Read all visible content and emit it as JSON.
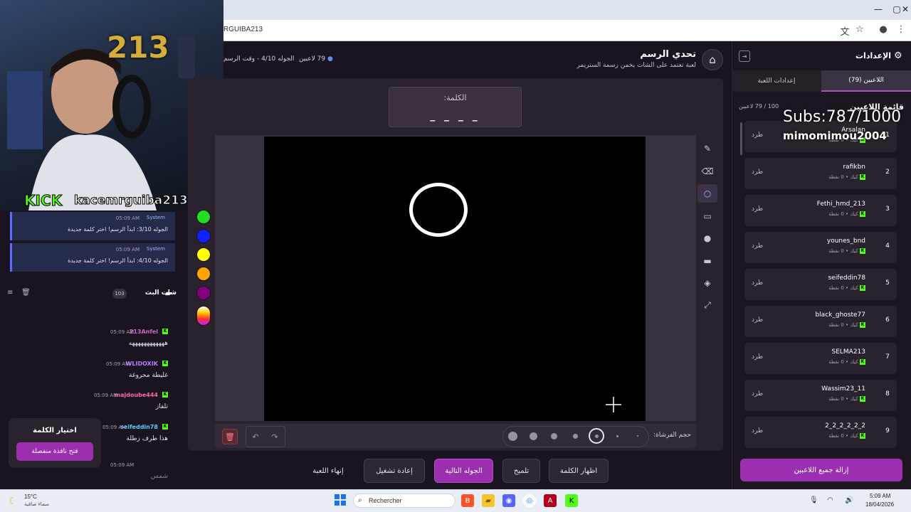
{
  "browser": {
    "url": "RGUIBA213",
    "window_controls": [
      "—",
      "▢",
      "✕"
    ]
  },
  "header": {
    "title": "تحدي الرسم",
    "subtitle": "لعبة تعتمد على الشات يخمن رسمة الستريمر",
    "round_info": "الجوله 4/10 - وقت الرسم",
    "player_count": "79 لاعبين"
  },
  "word": {
    "label": "الكلمة:",
    "hint": "_ _ _ _"
  },
  "toolbar": {
    "brush_size_label": "حجم الفرشاة:"
  },
  "actions": {
    "show_word": "اظهار الكلمة",
    "hint": "تلميح",
    "next_round": "الجوله التالية",
    "restart": "إعادة تشغيل",
    "end_game": "إنهاء اللعبة"
  },
  "sidebar": {
    "title": "الإعدادات",
    "tab_players": "اللاعبين (79)",
    "tab_game_settings": "إعدادات اللعبة",
    "player_list_title": "قائمة اللاعبين",
    "player_list_count": "100 / 79 لاعبين",
    "remove_all": "إزالة جميع اللاعبين",
    "kick_label": "طرد",
    "players": [
      {
        "rank": "1",
        "name": "Arsalan",
        "info": "كيك • 0 نقطة"
      },
      {
        "rank": "2",
        "name": "rafikbn",
        "info": "كيك • 0 نقطة"
      },
      {
        "rank": "3",
        "name": "Fethi_hmd_213",
        "info": "كيك • 0 نقطة"
      },
      {
        "rank": "4",
        "name": "younes_bnd",
        "info": "كيك • 0 نقطة"
      },
      {
        "rank": "5",
        "name": "seifeddin78",
        "info": "كيك • 0 نقطة"
      },
      {
        "rank": "6",
        "name": "black_ghoste77",
        "info": "كيك • 0 نقطة"
      },
      {
        "rank": "7",
        "name": "SELMA213",
        "info": "كيك • 0 نقطة"
      },
      {
        "rank": "8",
        "name": "Wassim23_11",
        "info": "كيك • 0 نقطة"
      },
      {
        "rank": "9",
        "name": "2_2_2_2_2_2",
        "info": "كيك • 0 نقطة"
      }
    ]
  },
  "overlay": {
    "subs": "Subs:787/1000",
    "user": "mimomimou2004",
    "kick_logo": "KICK",
    "kick_channel": "kacemrguiba213",
    "number": "213"
  },
  "chat": {
    "title": "شات البث",
    "count": "103",
    "system_messages": [
      {
        "name": "System",
        "time": "05:09 AM",
        "text": "الجوله 3/10: ابدأ الرسم! اختر كلمة جديدة"
      },
      {
        "name": "System",
        "time": "05:09 AM",
        "text": "الجوله 4/10: ابدأ الرسم! اختر كلمة جديدة"
      }
    ],
    "messages": [
      {
        "user": "213Anfel",
        "time": "05:09 AM",
        "text": "ههههههههههههه",
        "color": "#d85fd0"
      },
      {
        "user": "WLIDOXIK",
        "time": "05:09 AM",
        "text": "غليطة محروغة",
        "color": "#b87dff"
      },
      {
        "user": "majdoube444",
        "time": "05:09 AM",
        "text": "تلفاز",
        "color": "#ff6b9a"
      },
      {
        "user": "seifeddin78",
        "time": "05:09 AM",
        "text": "هذا طرف زطلة",
        "color": "#53d0ff"
      },
      {
        "user": "",
        "time": "05:09 AM",
        "text": "شمس",
        "color": "#ff6b9a"
      }
    ],
    "pick_word_title": "اختيار الكلمة",
    "pick_word_button": "فتح نافذة منفصلة"
  },
  "taskbar": {
    "temperature": "15°C",
    "weather": "سماء صافية",
    "search": "Rechercher",
    "time": "5:09 AM",
    "date": "18/04/2026"
  },
  "colors": {
    "accent": "#9c2fb0",
    "kick_green": "#53fc18",
    "swatches": [
      "#22dd22",
      "#1020ff",
      "#ffff00",
      "#ffa500",
      "#800080"
    ]
  }
}
